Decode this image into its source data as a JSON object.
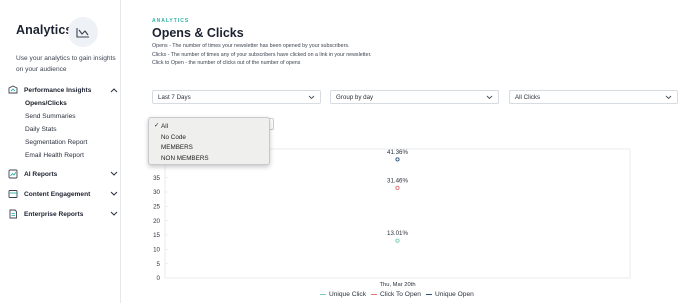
{
  "sidebar": {
    "title": "Analytics",
    "description": "Use your analytics to gain insights on your audience",
    "sections": [
      {
        "label": "Performance Insights",
        "icon": "performance-icon",
        "expanded": true,
        "items": [
          "Opens/Clicks",
          "Send Summaries",
          "Daily Stats",
          "Segmentation Report",
          "Email Health Report"
        ],
        "active": "Opens/Clicks"
      },
      {
        "label": "AI Reports",
        "icon": "ai-reports-icon",
        "expanded": false
      },
      {
        "label": "Content Engagement",
        "icon": "content-engagement-icon",
        "expanded": false
      },
      {
        "label": "Enterprise Reports",
        "icon": "enterprise-reports-icon",
        "expanded": false
      }
    ]
  },
  "header": {
    "kicker": "ANALYTICS",
    "title": "Opens & Clicks",
    "descriptions": [
      "Opens - The number of times your newsletter has been opened by your subscribers.",
      "Clicks - The number of times any of your subscribers have clicked on a link in your newsletter.",
      "Click to Open - the number of clicks out of the number of opens"
    ]
  },
  "filters": {
    "date_range": "Last 7 Days",
    "group_by": "Group by day",
    "clicks": "All Clicks"
  },
  "dropdown": {
    "options": [
      "All",
      "No Code",
      "MEMBERS",
      "NON MEMBERS"
    ],
    "selected": "All"
  },
  "colors": {
    "accent": "#2bb3a3",
    "unique_click": "#7ec8b8",
    "click_to_open": "#e57373",
    "unique_open": "#2f4f7f"
  },
  "chart_data": {
    "type": "line",
    "x": [
      "Thu, Mar 20th"
    ],
    "yticks": [
      0,
      5,
      10,
      15,
      20,
      25,
      30,
      35
    ],
    "ylim": [
      0,
      45
    ],
    "series": [
      {
        "name": "Unique Click",
        "values": [
          13.01
        ],
        "label": "13.01%",
        "color": "#7ec8b8"
      },
      {
        "name": "Click To Open",
        "values": [
          31.46
        ],
        "label": "31.46%",
        "color": "#e57373"
      },
      {
        "name": "Unique Open",
        "values": [
          41.36
        ],
        "label": "41.36%",
        "color": "#2f4f7f"
      }
    ],
    "legend_position": "bottom"
  }
}
